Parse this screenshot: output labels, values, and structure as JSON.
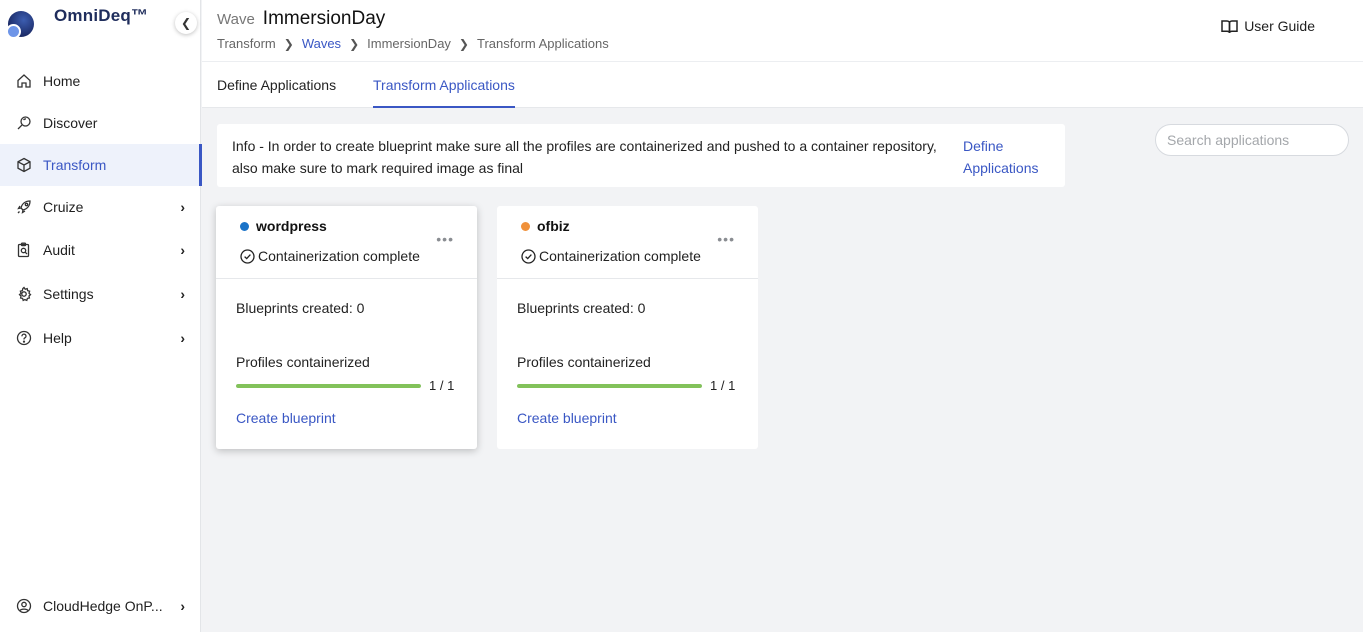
{
  "brand": {
    "name": "OmniDeq™"
  },
  "sidebar": {
    "collapse_icon": "chevron-left-icon",
    "items": [
      {
        "label": "Home",
        "icon": "home-icon",
        "has_submenu": false,
        "active": false
      },
      {
        "label": "Discover",
        "icon": "discover-icon",
        "has_submenu": false,
        "active": false
      },
      {
        "label": "Transform",
        "icon": "cube-icon",
        "has_submenu": false,
        "active": true
      },
      {
        "label": "Cruize",
        "icon": "rocket-icon",
        "has_submenu": true,
        "active": false
      },
      {
        "label": "Audit",
        "icon": "clipboard-search-icon",
        "has_submenu": true,
        "active": false
      },
      {
        "label": "Settings",
        "icon": "gear-icon",
        "has_submenu": true,
        "active": false
      },
      {
        "label": "Help",
        "icon": "help-icon",
        "has_submenu": true,
        "active": false
      }
    ],
    "footer": {
      "label": "CloudHedge OnP...",
      "icon": "user-circle-icon"
    }
  },
  "header": {
    "title_prefix": "Wave",
    "title": "ImmersionDay",
    "breadcrumb": [
      "Transform",
      "Waves",
      "ImmersionDay",
      "Transform Applications"
    ],
    "user_guide": "User Guide"
  },
  "tabs": [
    {
      "label": "Define Applications",
      "active": false
    },
    {
      "label": "Transform Applications",
      "active": true
    }
  ],
  "info": {
    "text": "Info - In order to create blueprint make sure all the profiles are containerized and pushed to a container repository, also make sure to mark required image as final",
    "link": "Define Applications"
  },
  "search": {
    "placeholder": "Search applications",
    "value": ""
  },
  "cards": [
    {
      "name": "wordpress",
      "dot_color": "#1a73c8",
      "status": "Containerization complete",
      "blueprints": "Blueprints created: 0",
      "profiles_label": "Profiles containerized",
      "progress": 1.0,
      "progress_text": "1 / 1",
      "action": "Create blueprint"
    },
    {
      "name": "ofbiz",
      "dot_color": "#f0913a",
      "status": "Containerization complete",
      "blueprints": "Blueprints created: 0",
      "profiles_label": "Profiles containerized",
      "progress": 1.0,
      "progress_text": "1 / 1",
      "action": "Create blueprint"
    }
  ],
  "colors": {
    "accent": "#3a57c4",
    "progress": "#82c25a"
  }
}
